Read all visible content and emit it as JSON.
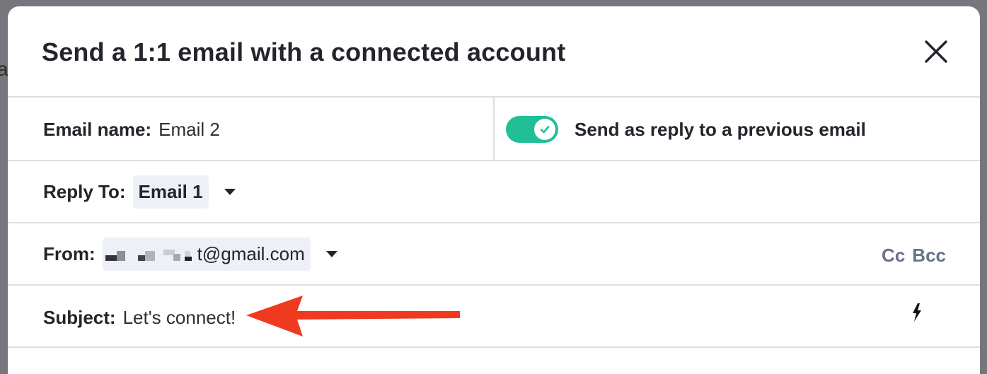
{
  "backdrop": {
    "letter": "a"
  },
  "modal": {
    "title": "Send a 1:1 email with a connected account"
  },
  "email_name": {
    "label": "Email name:",
    "value": "Email 2"
  },
  "reply_toggle": {
    "label": "Send as reply to a previous email",
    "state": "on",
    "color": "#21bf96"
  },
  "reply_to": {
    "label": "Reply To:",
    "selected": "Email 1"
  },
  "from": {
    "label": "From:",
    "value_visible": "t@gmail.com"
  },
  "cc_bcc": {
    "cc": "Cc",
    "bcc": "Bcc"
  },
  "subject": {
    "label": "Subject:",
    "value": "Let's connect!",
    "personalize_icon": "lightning-bolt-icon"
  },
  "annotation": {
    "arrow_color": "#f03a1f"
  }
}
